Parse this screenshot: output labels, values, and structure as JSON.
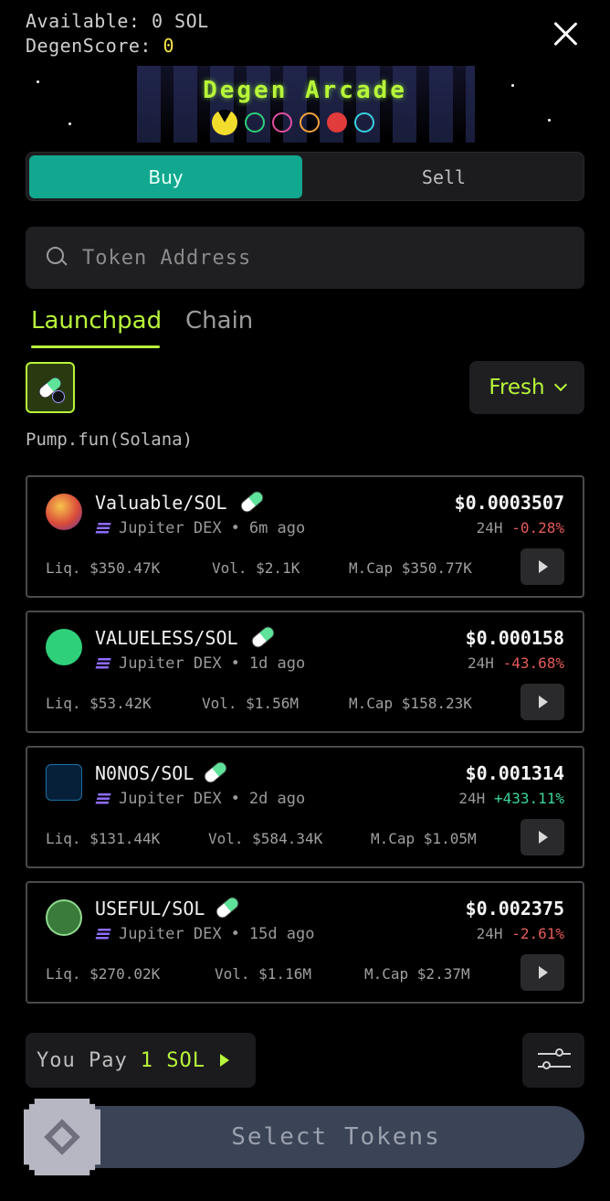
{
  "header": {
    "available_label": "Available: 0 SOL",
    "degen_label": "DegenScore:",
    "degen_value": "0",
    "banner_title": "Degen Arcade"
  },
  "trade": {
    "buy_label": "Buy",
    "sell_label": "Sell"
  },
  "search": {
    "placeholder": "Token Address",
    "value": ""
  },
  "tabs": {
    "launchpad": "Launchpad",
    "chain": "Chain"
  },
  "filter": {
    "selected": "Fresh"
  },
  "platform_label": "Pump.fun(Solana)",
  "tokens": [
    {
      "pair": "Valuable/SOL",
      "dex": "Jupiter DEX",
      "age": "6m ago",
      "price": "$0.0003507",
      "chg_prefix": "24H",
      "chg": "-0.28%",
      "liq": "Liq. $350.47K",
      "vol": "Vol. $2.1K",
      "mcap": "M.Cap $350.77K"
    },
    {
      "pair": "VALUELESS/SOL",
      "dex": "Jupiter DEX",
      "age": "1d ago",
      "price": "$0.000158",
      "chg_prefix": "24H",
      "chg": "-43.68%",
      "liq": "Liq. $53.42K",
      "vol": "Vol. $1.56M",
      "mcap": "M.Cap $158.23K"
    },
    {
      "pair": "N0NOS/SOL",
      "dex": "Jupiter DEX",
      "age": "2d ago",
      "price": "$0.001314",
      "chg_prefix": "24H",
      "chg": "+433.11%",
      "liq": "Liq. $131.44K",
      "vol": "Vol. $584.34K",
      "mcap": "M.Cap $1.05M"
    },
    {
      "pair": "USEFUL/SOL",
      "dex": "Jupiter DEX",
      "age": "15d ago",
      "price": "$0.002375",
      "chg_prefix": "24H",
      "chg": "-2.61%",
      "liq": "Liq. $270.02K",
      "vol": "Vol. $1.16M",
      "mcap": "M.Cap $2.37M"
    }
  ],
  "footer": {
    "you_pay_label": "You Pay",
    "you_pay_amount": "1 SOL",
    "select_label": "Select Tokens"
  },
  "colors": {
    "accent": "#b8f53a",
    "buy": "#12a88f",
    "negative": "#e45a5a",
    "positive": "#3bd59a"
  }
}
